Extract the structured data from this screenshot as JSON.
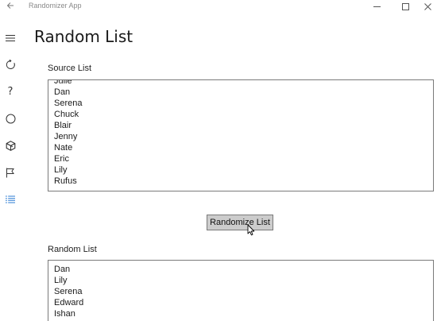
{
  "window": {
    "title": "Randomizer App",
    "back_icon": "back-arrow-icon",
    "controls": [
      "minimize-icon",
      "maximize-icon",
      "close-icon"
    ]
  },
  "nav_rail": [
    {
      "icon": "hamburger-menu-icon"
    },
    {
      "icon": "refresh-icon"
    },
    {
      "icon": "help-icon"
    },
    {
      "icon": "circle-icon"
    },
    {
      "icon": "cube-icon"
    },
    {
      "icon": "flag-icon"
    },
    {
      "icon": "list-icon",
      "active": true,
      "color": "#2b7bd3"
    }
  ],
  "page": {
    "title": "Random List"
  },
  "source": {
    "label": "Source List",
    "items": [
      "Julie",
      "Dan",
      "Serena",
      "Chuck",
      "Blair",
      "Jenny",
      "Nate",
      "Eric",
      "Lily",
      "Rufus"
    ]
  },
  "action": {
    "randomize_label": "Randomize List"
  },
  "random": {
    "label": "Random List",
    "items": [
      "Dan",
      "Lily",
      "Serena",
      "Edward",
      "Ishan"
    ]
  },
  "colors": {
    "button_bg": "#cccccc",
    "border": "#7a7a7a",
    "accent": "#2b7bd3"
  }
}
